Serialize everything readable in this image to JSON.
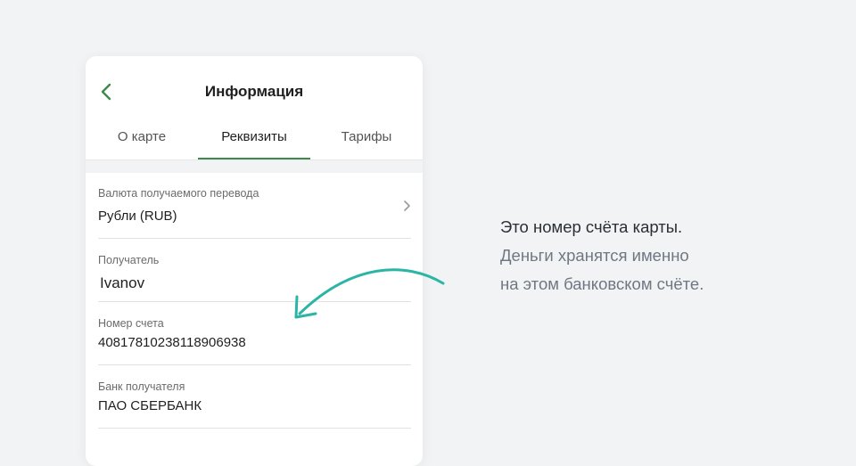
{
  "header": {
    "title": "Информация",
    "back_icon": "chevron-left-icon"
  },
  "tabs": [
    {
      "label": "О карте",
      "active": false
    },
    {
      "label": "Реквизиты",
      "active": true
    },
    {
      "label": "Тарифы",
      "active": false
    }
  ],
  "fields": [
    {
      "label": "Валюта получаемого перевода",
      "value": "Рубли (RUB)",
      "has_chevron": true
    },
    {
      "label": "Получатель",
      "value": "Ivanov",
      "has_chevron": false
    },
    {
      "label": "Номер счета",
      "value": "40817810238118906938",
      "has_chevron": false
    },
    {
      "label": "Банк получателя",
      "value": "ПАО СБЕРБАНК",
      "has_chevron": false
    }
  ],
  "annotation": {
    "line1": "Это номер счёта карты.",
    "line2": "Деньги хранятся именно",
    "line3": "на этом банковском счёте."
  },
  "colors": {
    "accent_green": "#3d8a4b",
    "arrow_teal": "#2bb5a5",
    "background": "#f2f3f5"
  }
}
